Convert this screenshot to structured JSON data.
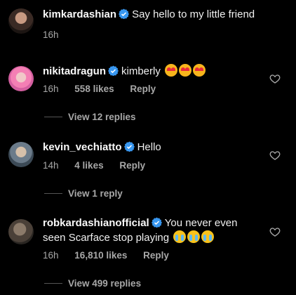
{
  "comments": [
    {
      "username": "kimkardashian",
      "verified": true,
      "text": "Say hello to my little friend",
      "time": "16h",
      "avatar": "kim-avatar"
    },
    {
      "username": "nikitadragun",
      "verified": true,
      "text": "kimberly",
      "emojis": [
        "heart-eyes-emoji",
        "heart-eyes-emoji",
        "heart-eyes-emoji"
      ],
      "time": "16h",
      "likes": "558 likes",
      "reply": "Reply",
      "view_replies": "View 12 replies"
    },
    {
      "username": "kevin_vechiatto",
      "verified": true,
      "text": "Hello",
      "time": "14h",
      "likes": "4 likes",
      "reply": "Reply",
      "view_replies": "View 1 reply"
    },
    {
      "username": "robkardashianofficial",
      "verified": true,
      "text_line1": "You never even",
      "text_line2": "seen Scarface stop playing",
      "emojis": [
        "crying-emoji",
        "crying-emoji",
        "crying-emoji"
      ],
      "time": "16h",
      "likes": "16,810 likes",
      "reply": "Reply",
      "view_replies": "View 499 replies"
    }
  ],
  "colors": {
    "background": "#000000",
    "primary_text": "#f5f5f5",
    "secondary_text": "#a8a8a8",
    "verified_blue": "#3897f0"
  }
}
